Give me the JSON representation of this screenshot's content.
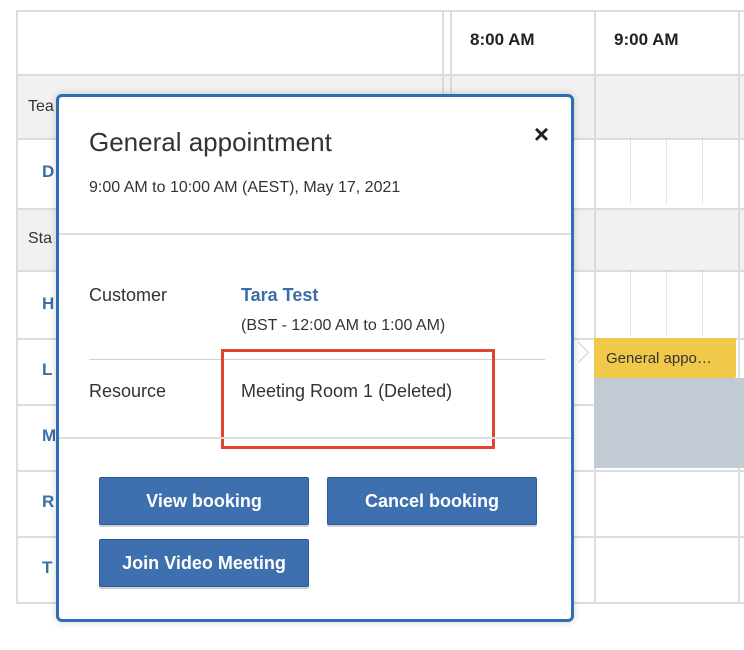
{
  "calendar": {
    "times": [
      "8:00 AM",
      "9:00 AM"
    ],
    "group_labels": [
      "Tea",
      "Sta"
    ],
    "row_links": [
      "D",
      "H",
      "L",
      "M",
      "R",
      "T"
    ],
    "appointment_block": "General appo…"
  },
  "popup": {
    "title": "General appointment",
    "close_label": "×",
    "subtitle": "9:00 AM to 10:00 AM (AEST), May 17, 2021",
    "customer_label": "Customer",
    "customer_name": "Tara Test",
    "customer_note": "(BST - 12:00 AM to 1:00 AM)",
    "resource_label": "Resource",
    "resource_value": "Meeting Room 1 (Deleted)",
    "buttons": {
      "view": "View booking",
      "cancel": "Cancel booking",
      "join": "Join Video Meeting"
    }
  },
  "colors": {
    "accent": "#3e6faf",
    "link": "#3b6ea8",
    "appointment": "#f0c94b",
    "highlight": "#e0442e"
  }
}
